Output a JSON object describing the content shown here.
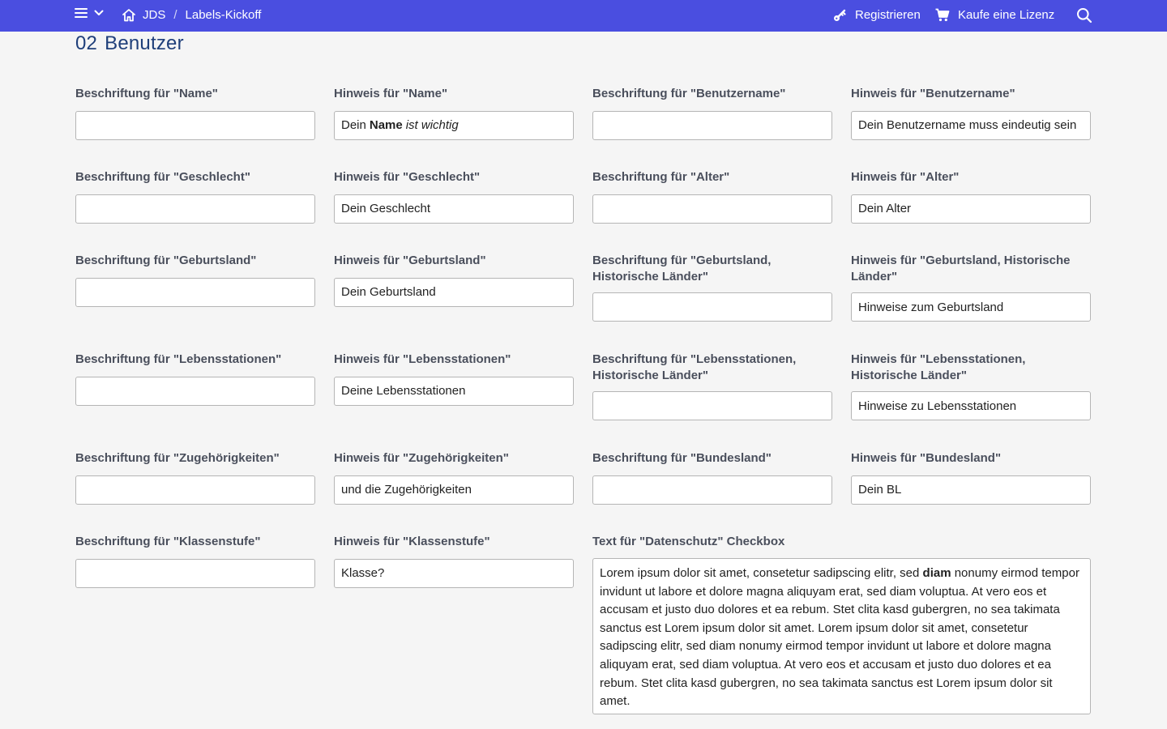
{
  "header": {
    "breadcrumb": {
      "home": "JDS",
      "separator": "/",
      "current": "Labels-Kickoff"
    },
    "register": "Registrieren",
    "buy_license": "Kaufe eine Lizenz",
    "icons": [
      "menu-icon",
      "chevron-down-icon",
      "home-icon",
      "key-icon",
      "cart-icon",
      "search-icon"
    ],
    "background_color": "#4a4ee0"
  },
  "page": {
    "number": "02",
    "title": "Benutzer"
  },
  "fields": {
    "name_label": {
      "label": "Beschriftung für \"Name\"",
      "value": ""
    },
    "name_hint": {
      "label": "Hinweis für \"Name\"",
      "value_pre": "Dein",
      "value_bold": "Name",
      "value_italic": "ist wichtig"
    },
    "username_label": {
      "label": "Beschriftung für \"Benutzername\"",
      "value": ""
    },
    "username_hint": {
      "label": "Hinweis für \"Benutzername\"",
      "value": "Dein Benutzername muss eindeutig sein"
    },
    "gender_label": {
      "label": "Beschriftung für \"Geschlecht\"",
      "value": ""
    },
    "gender_hint": {
      "label": "Hinweis für \"Geschlecht\"",
      "value": "Dein Geschlecht"
    },
    "age_label": {
      "label": "Beschriftung für \"Alter\"",
      "value": ""
    },
    "age_hint": {
      "label": "Hinweis für \"Alter\"",
      "value": "Dein Alter"
    },
    "birthcountry_label": {
      "label": "Beschriftung für \"Geburtsland\"",
      "value": ""
    },
    "birthcountry_hint": {
      "label": "Hinweis für \"Geburtsland\"",
      "value": "Dein Geburtsland"
    },
    "birthcountry_hist_label": {
      "label_line1": "Beschriftung für \"Geburtsland,",
      "label_line2": "Historische Länder\"",
      "value": ""
    },
    "birthcountry_hist_hint": {
      "label_line1": "Hinweis für \"Geburtsland, Historische",
      "label_line2": "Länder\"",
      "value": "Hinweise zum Geburtsland"
    },
    "stations_label": {
      "label": "Beschriftung für \"Lebensstationen\"",
      "value": ""
    },
    "stations_hint": {
      "label": "Hinweis für \"Lebensstationen\"",
      "value": "Deine Lebensstationen"
    },
    "stations_hist_label": {
      "label_line1": "Beschriftung für \"Lebensstationen,",
      "label_line2": "Historische Länder\"",
      "value": ""
    },
    "stations_hist_hint": {
      "label_line1": "Hinweis für \"Lebensstationen,",
      "label_line2": "Historische Länder\"",
      "value": "Hinweise zu Lebensstationen"
    },
    "affiliations_label": {
      "label": "Beschriftung für \"Zugehörigkeiten\"",
      "value": ""
    },
    "affiliations_hint": {
      "label": "Hinweis für \"Zugehörigkeiten\"",
      "value": "und die Zugehörigkeiten"
    },
    "state_label": {
      "label": "Beschriftung für \"Bundesland\"",
      "value": ""
    },
    "state_hint": {
      "label": "Hinweis für \"Bundesland\"",
      "value": "Dein BL"
    },
    "grade_label": {
      "label": "Beschriftung für \"Klassenstufe\"",
      "value": ""
    },
    "grade_hint": {
      "label": "Hinweis für \"Klassenstufe\"",
      "value": "Klasse?"
    },
    "privacy_text": {
      "label": "Text für \"Datenschutz\" Checkbox",
      "value_pre": "Lorem ipsum dolor sit amet, consetetur sadipscing elitr, sed",
      "value_bold": "diam",
      "value_post": "nonumy eirmod tempor invidunt ut labore et dolore magna aliquyam erat, sed diam voluptua. At vero eos et accusam et justo duo dolores et ea rebum. Stet clita kasd gubergren, no sea takimata sanctus est Lorem ipsum dolor sit amet. Lorem ipsum dolor sit amet, consetetur sadipscing elitr, sed diam nonumy eirmod tempor invidunt ut labore et dolore magna aliquyam erat, sed diam voluptua. At vero eos et accusam et justo duo dolores et ea rebum. Stet clita kasd gubergren, no sea takimata sanctus est Lorem ipsum dolor sit amet."
    }
  }
}
